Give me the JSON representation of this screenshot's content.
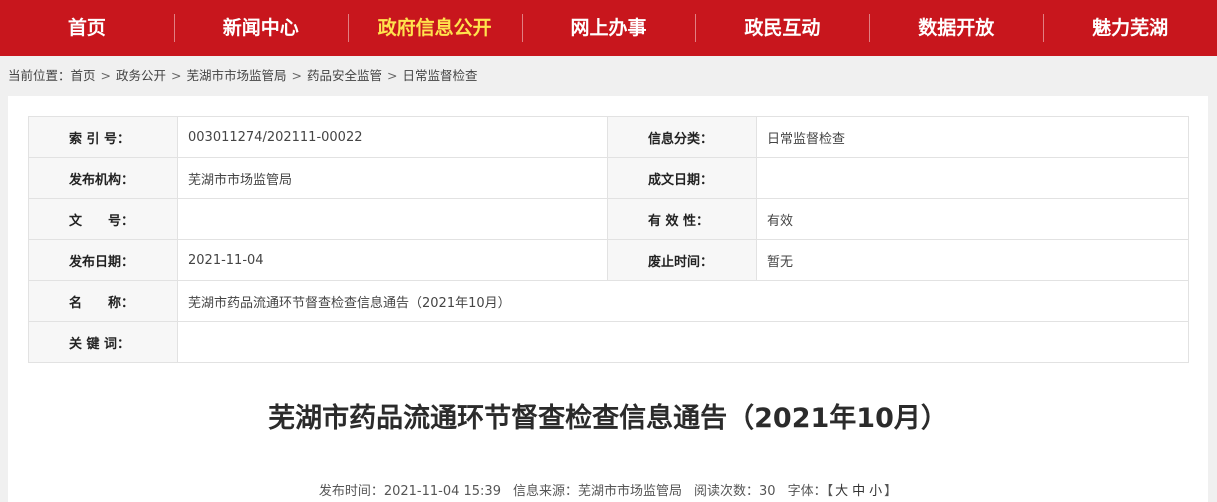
{
  "nav": {
    "items": [
      {
        "label": "首页"
      },
      {
        "label": "新闻中心"
      },
      {
        "label": "政府信息公开"
      },
      {
        "label": "网上办事"
      },
      {
        "label": "政民互动"
      },
      {
        "label": "数据开放"
      },
      {
        "label": "魅力芜湖"
      }
    ],
    "active_index": 2,
    "bg_color": "#c8161d",
    "active_color": "#ffe34d"
  },
  "breadcrumb": {
    "prefix": "当前位置：",
    "items": [
      "首页",
      "政务公开",
      "芜湖市市场监管局",
      "药品安全监管",
      "日常监督检查"
    ],
    "separator": ">"
  },
  "meta": {
    "index_label": "索 引 号：",
    "index_value": "003011274/202111-00022",
    "category_label": "信息分类：",
    "category_value": "日常监督检查",
    "publisher_label": "发布机构：",
    "publisher_value": "芜湖市市场监管局",
    "written_date_label": "成文日期：",
    "written_date_value": "",
    "doc_no_label": "文　　号：",
    "doc_no_value": "",
    "validity_label": "有 效 性：",
    "validity_value": "有效",
    "publish_date_label": "发布日期：",
    "publish_date_value": "2021-11-04",
    "expiry_label": "废止时间：",
    "expiry_value": "暂无",
    "name_label": "名　　称：",
    "name_value": "芜湖市药品流通环节督查检查信息通告（2021年10月）",
    "keywords_label": "关 键 词：",
    "keywords_value": ""
  },
  "article": {
    "title": "芜湖市药品流通环节督查检查信息通告（2021年10月）",
    "publish_time_label": "发布时间：",
    "publish_time": "2021-11-04 15:39",
    "source_label": "信息来源：",
    "source": "芜湖市市场监管局",
    "views_label": "阅读次数：",
    "views": "30",
    "font_label": "字体：",
    "font_open": "【",
    "font_large": "大",
    "font_medium": "中",
    "font_small": "小",
    "font_close": "】"
  }
}
